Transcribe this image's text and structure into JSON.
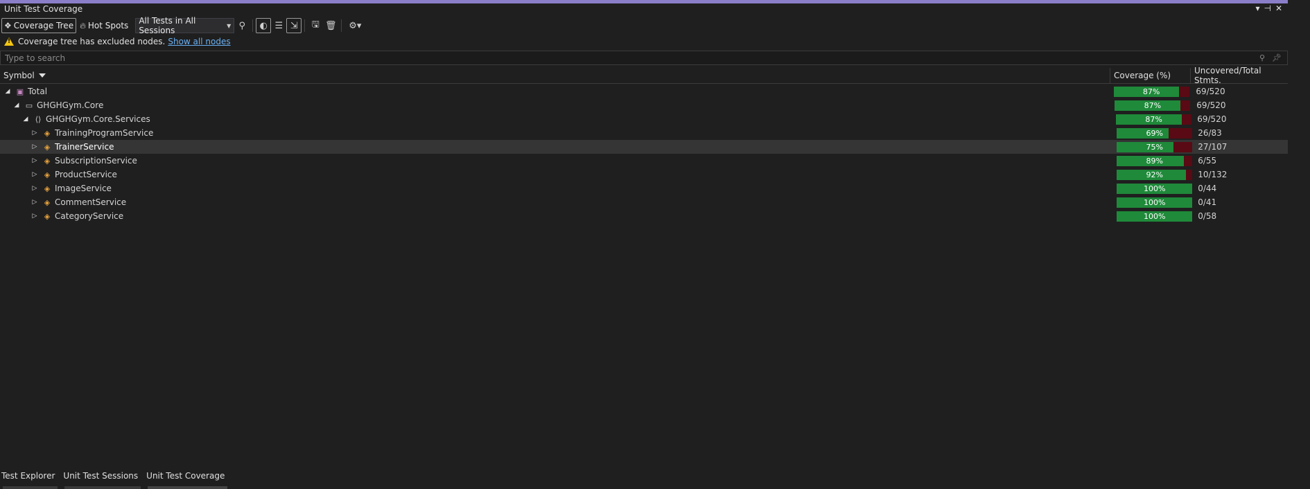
{
  "window": {
    "title": "Unit Test Coverage"
  },
  "toolbar": {
    "coverage_tree_label": "Coverage Tree",
    "hot_spots_label": "Hot Spots",
    "session_select": "All Tests in All Sessions"
  },
  "warning": {
    "message": "Coverage tree has excluded nodes.",
    "link": "Show all nodes"
  },
  "search": {
    "placeholder": "Type to search"
  },
  "columns": {
    "symbol": "Symbol",
    "coverage": "Coverage (%)",
    "uncovered": "Uncovered/Total Stmts."
  },
  "rows": [
    {
      "label": "Total",
      "coverage": 87,
      "coverage_text": "87%",
      "uncovered": "69/520",
      "level": 0,
      "icon": "solution-icon",
      "expanded": true
    },
    {
      "label": "GHGHGym.Core",
      "coverage": 87,
      "coverage_text": "87%",
      "uncovered": "69/520",
      "level": 1,
      "icon": "assembly-icon",
      "expanded": true
    },
    {
      "label": "GHGHGym.Core.Services",
      "coverage": 87,
      "coverage_text": "87%",
      "uncovered": "69/520",
      "level": 2,
      "icon": "namespace-icon",
      "expanded": true
    },
    {
      "label": "TrainingProgramService",
      "coverage": 69,
      "coverage_text": "69%",
      "uncovered": "26/83",
      "level": 3,
      "icon": "class-icon",
      "expanded": false
    },
    {
      "label": "TrainerService",
      "coverage": 75,
      "coverage_text": "75%",
      "uncovered": "27/107",
      "level": 3,
      "icon": "class-icon",
      "expanded": false,
      "selected": true
    },
    {
      "label": "SubscriptionService",
      "coverage": 89,
      "coverage_text": "89%",
      "uncovered": "6/55",
      "level": 3,
      "icon": "class-icon",
      "expanded": false
    },
    {
      "label": "ProductService",
      "coverage": 92,
      "coverage_text": "92%",
      "uncovered": "10/132",
      "level": 3,
      "icon": "class-icon",
      "expanded": false
    },
    {
      "label": "ImageService",
      "coverage": 100,
      "coverage_text": "100%",
      "uncovered": "0/44",
      "level": 3,
      "icon": "class-icon",
      "expanded": false
    },
    {
      "label": "CommentService",
      "coverage": 100,
      "coverage_text": "100%",
      "uncovered": "0/41",
      "level": 3,
      "icon": "class-icon",
      "expanded": false
    },
    {
      "label": "CategoryService",
      "coverage": 100,
      "coverage_text": "100%",
      "uncovered": "0/58",
      "level": 3,
      "icon": "class-icon",
      "expanded": false
    }
  ],
  "tabs": [
    {
      "label": "Test Explorer"
    },
    {
      "label": "Unit Test Sessions"
    },
    {
      "label": "Unit Test Coverage",
      "active": true
    }
  ],
  "colors": {
    "covered": "#1f8a3a",
    "uncovered": "#5a0a14",
    "accent": "#8b7ec8",
    "warning": "#f2c511",
    "link": "#6ab0f3"
  }
}
